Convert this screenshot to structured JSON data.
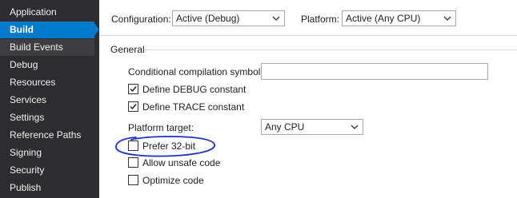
{
  "sidebar": {
    "items": [
      {
        "label": "Application",
        "state": "normal"
      },
      {
        "label": "Build",
        "state": "selected"
      },
      {
        "label": "Build Events",
        "state": "hover"
      },
      {
        "label": "Debug",
        "state": "normal"
      },
      {
        "label": "Resources",
        "state": "normal"
      },
      {
        "label": "Services",
        "state": "normal"
      },
      {
        "label": "Settings",
        "state": "normal"
      },
      {
        "label": "Reference Paths",
        "state": "normal"
      },
      {
        "label": "Signing",
        "state": "normal"
      },
      {
        "label": "Security",
        "state": "normal"
      },
      {
        "label": "Publish",
        "state": "normal"
      }
    ]
  },
  "toolbar": {
    "configuration_label": "Configuration:",
    "configuration_value": "Active (Debug)",
    "platform_label": "Platform:",
    "platform_value": "Active (Any CPU)"
  },
  "general": {
    "title": "General",
    "conditional_symbols_label": "Conditional compilation symbols:",
    "conditional_symbols_value": "",
    "define_debug_label": "Define DEBUG constant",
    "define_debug_checked": true,
    "define_trace_label": "Define TRACE constant",
    "define_trace_checked": true,
    "platform_target_label": "Platform target:",
    "platform_target_value": "Any CPU",
    "prefer32_label": "Prefer 32-bit",
    "prefer32_checked": false,
    "unsafe_label": "Allow unsafe code",
    "unsafe_checked": false,
    "optimize_label": "Optimize code",
    "optimize_checked": false
  },
  "colors": {
    "sidebar_bg": "#2d2d30",
    "selected_accent": "#007acc",
    "annotation_ink": "#1a2fc8"
  }
}
